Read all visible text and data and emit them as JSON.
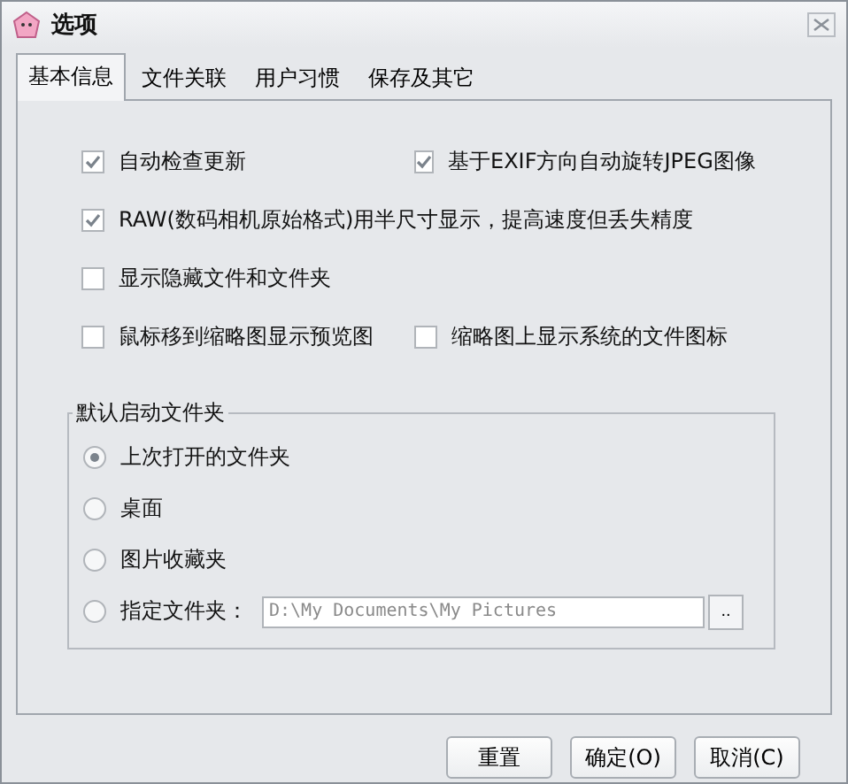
{
  "window": {
    "title": "选项"
  },
  "tabs": [
    {
      "label": "基本信息",
      "selected": true
    },
    {
      "label": "文件关联",
      "selected": false
    },
    {
      "label": "用户习惯",
      "selected": false
    },
    {
      "label": "保存及其它",
      "selected": false
    }
  ],
  "option_rows": [
    [
      {
        "label": "自动检查更新",
        "checked": true
      },
      {
        "label": "基于EXIF方向自动旋转JPEG图像",
        "checked": true
      }
    ],
    [
      {
        "label": "RAW(数码相机原始格式)用半尺寸显示，提高速度但丢失精度",
        "checked": true
      }
    ],
    [
      {
        "label": "显示隐藏文件和文件夹",
        "checked": false
      }
    ],
    [
      {
        "label": "鼠标移到缩略图显示预览图",
        "checked": false
      },
      {
        "label": "缩略图上显示系统的文件图标",
        "checked": false
      }
    ]
  ],
  "startup_folder": {
    "title": "默认启动文件夹",
    "options": [
      {
        "label": "上次打开的文件夹",
        "selected": true
      },
      {
        "label": "桌面",
        "selected": false
      },
      {
        "label": "图片收藏夹",
        "selected": false
      },
      {
        "label": "指定文件夹：",
        "selected": false,
        "path": "D:\\My Documents\\My Pictures",
        "browse": ".."
      }
    ]
  },
  "buttons": [
    "重置",
    "确定(O)",
    "取消(C)"
  ]
}
